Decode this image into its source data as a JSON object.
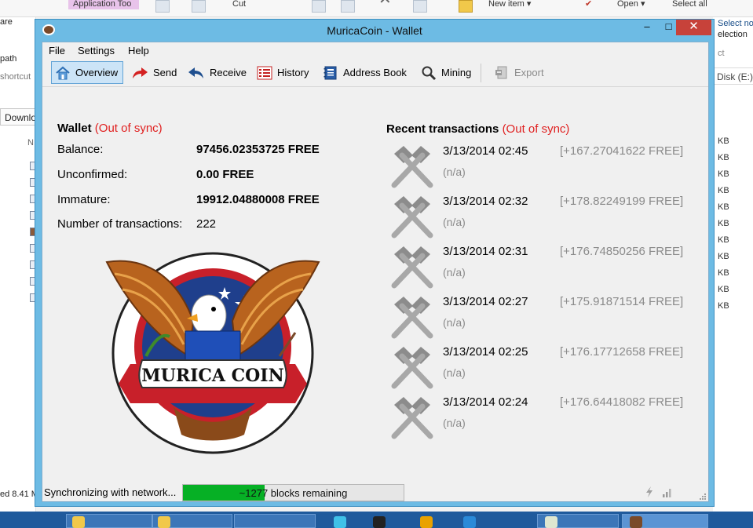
{
  "background": {
    "ribbon": {
      "app_tools": "Application Too",
      "cut": "Cut",
      "new_item": "New item ▾",
      "open": "Open ▾",
      "select_all": "Select all",
      "select_none": "Select none",
      "selection": "election",
      "ct": "ct"
    },
    "left_pane": {
      "are": "are",
      "path": "path",
      "shortcut": "shortcut",
      "download": "Downlo",
      "col_n": "N"
    },
    "right_pane": {
      "disk": "Disk (E:)",
      "kb": [
        "KB",
        "KB",
        "KB",
        "KB",
        "KB",
        "KB",
        "KB",
        "KB",
        "KB",
        "KB",
        "KB"
      ]
    },
    "status": "ed  8.41 M"
  },
  "window": {
    "title": "MuricaCoin - Wallet",
    "close_glyph": "✕",
    "min_glyph": "–",
    "max_glyph": "□"
  },
  "menu": {
    "file": "File",
    "settings": "Settings",
    "help": "Help"
  },
  "toolbar": {
    "overview": "Overview",
    "send": "Send",
    "receive": "Receive",
    "history": "History",
    "address_book": "Address Book",
    "mining": "Mining",
    "export": "Export"
  },
  "wallet": {
    "header": "Wallet",
    "status": "(Out of sync)",
    "balance_label": "Balance:",
    "balance_value": "97456.02353725 FREE",
    "unconfirmed_label": "Unconfirmed:",
    "unconfirmed_value": "0.00 FREE",
    "immature_label": "Immature:",
    "immature_value": "19912.04880008 FREE",
    "num_tx_label": "Number of transactions:",
    "num_tx_value": "222"
  },
  "logo": {
    "text": "MURICA COIN"
  },
  "recent": {
    "header": "Recent transactions",
    "status": "(Out of sync)",
    "items": [
      {
        "date": "3/13/2014 02:45",
        "amount": "[+167.27041622 FREE]",
        "label": "(n/a)"
      },
      {
        "date": "3/13/2014 02:32",
        "amount": "[+178.82249199 FREE]",
        "label": "(n/a)"
      },
      {
        "date": "3/13/2014 02:31",
        "amount": "[+176.74850256 FREE]",
        "label": "(n/a)"
      },
      {
        "date": "3/13/2014 02:27",
        "amount": "[+175.91871514 FREE]",
        "label": "(n/a)"
      },
      {
        "date": "3/13/2014 02:25",
        "amount": "[+176.17712658 FREE]",
        "label": "(n/a)"
      },
      {
        "date": "3/13/2014 02:24",
        "amount": "[+176.64418082 FREE]",
        "label": "(n/a)"
      }
    ]
  },
  "status_bar": {
    "sync_text": "Synchronizing with network...",
    "progress_text": "~1277 blocks remaining",
    "progress_fraction": 0.37
  },
  "colors": {
    "out_of_sync": "#e02020",
    "progress_fill": "#06b025",
    "title_bar": "#6dbbe4",
    "close_button": "#c7423a"
  }
}
